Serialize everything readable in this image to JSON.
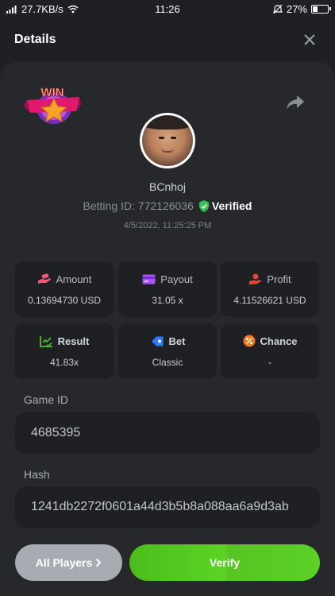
{
  "status_bar": {
    "network_speed": "27.7KB/s",
    "time": "11:26",
    "battery_percent": "27%"
  },
  "header": {
    "title": "Details",
    "close_icon": "close-icon"
  },
  "bet": {
    "badge": "WIN",
    "username": "BCnhoj",
    "betting_id": "Betting ID: 772126036",
    "verified_label": "Verified",
    "timestamp": "4/5/2022, 11:25:25 PM"
  },
  "stats": {
    "amount": {
      "label": "Amount",
      "value": "0.13694730 USD",
      "icon": "money-hand-icon",
      "color": "#f05a7a"
    },
    "payout": {
      "label": "Payout",
      "value": "31.05 x",
      "icon": "card-icon",
      "color": "#a855f7"
    },
    "profit": {
      "label": "Profit",
      "value": "4.11526621 USD",
      "icon": "coin-hand-icon",
      "color": "#e8433a"
    },
    "result": {
      "label": "Result",
      "value": "41.83x",
      "icon": "chart-check-icon",
      "color": "#4fbf2a"
    },
    "bet": {
      "label": "Bet",
      "value": "Classic",
      "icon": "ticket-icon",
      "color": "#2d7cf5"
    },
    "chance": {
      "label": "Chance",
      "value": "-",
      "icon": "percent-icon",
      "color": "#f07a1a"
    }
  },
  "game": {
    "game_id_label": "Game ID",
    "game_id": "4685395",
    "hash_label": "Hash",
    "hash": "1241db2272f0601a44d3b5b8a088aa6a9d3ab"
  },
  "actions": {
    "all_players": "All Players",
    "verify": "Verify"
  }
}
